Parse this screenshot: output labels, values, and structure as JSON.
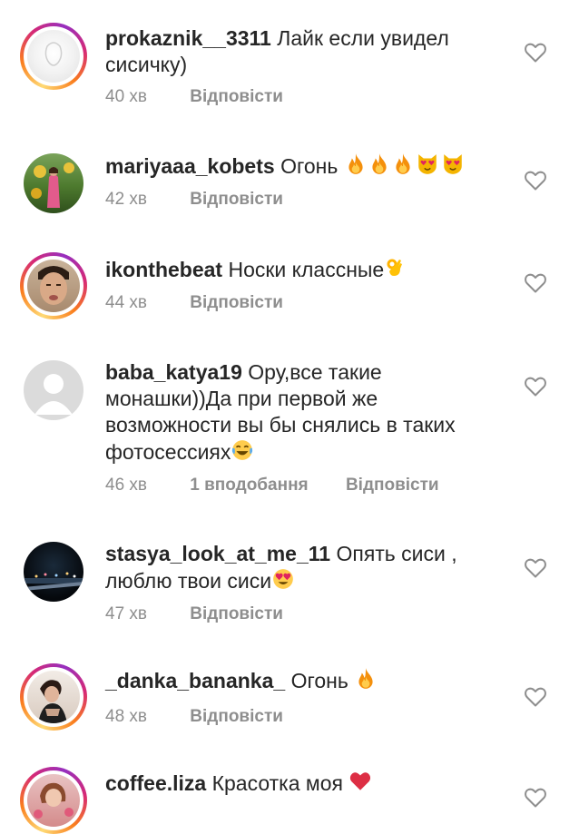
{
  "comments": [
    {
      "username": "prokaznik__3311",
      "text": "Лайк если увидел сисичку)",
      "time": "40 хв",
      "likes": "",
      "reply": "Відповісти",
      "emojis": []
    },
    {
      "username": "mariyaaa_kobets",
      "text": "Огонь",
      "time": "42 хв",
      "likes": "",
      "reply": "Відповісти",
      "emojis": [
        "fire-emoji",
        "fire-emoji",
        "fire-emoji",
        "heart-eyes-cat-emoji",
        "heart-eyes-cat-emoji"
      ]
    },
    {
      "username": "ikonthebeat",
      "text": "Носки классные",
      "time": "44 хв",
      "likes": "",
      "reply": "Відповісти",
      "emojis": [
        "ok-hand-emoji"
      ]
    },
    {
      "username": "baba_katya19",
      "text": "Ору,все такие монашки))Да при первой же возможности вы бы снялись в таких фотосессиях",
      "time": "46 хв",
      "likes": "1 вподобання",
      "reply": "Відповісти",
      "emojis": [
        "tears-of-joy-emoji"
      ]
    },
    {
      "username": "stasya_look_at_me_11",
      "text": "Опять сиси , люблю твои сиси",
      "time": "47 хв",
      "likes": "",
      "reply": "Відповісти",
      "emojis": [
        "heart-eyes-emoji"
      ]
    },
    {
      "username": "_danka_bananka_",
      "text": "Огонь",
      "time": "48 хв",
      "likes": "",
      "reply": "Відповісти",
      "emojis": [
        "fire-emoji"
      ]
    },
    {
      "username": "coffee.liza",
      "text": "Красотка моя",
      "time": "",
      "likes": "",
      "reply": "",
      "emojis": [
        "red-heart-emoji"
      ]
    }
  ],
  "colors": {
    "text": "#262626",
    "secondary": "#8e8e8e",
    "background": "#ffffff"
  }
}
